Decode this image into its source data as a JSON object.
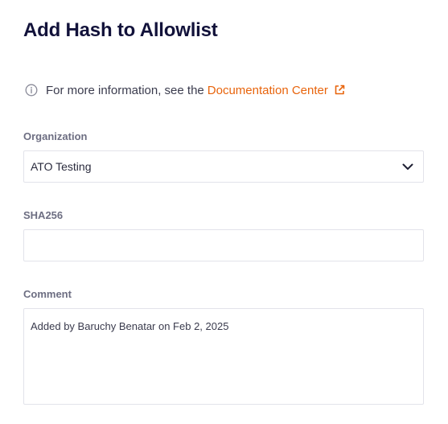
{
  "page": {
    "title": "Add Hash to Allowlist"
  },
  "info": {
    "text": "For more information, see the",
    "link_label": "Documentation Center",
    "icon": "info-circle-icon",
    "link_icon": "external-link-icon",
    "link_color": "#e8640c"
  },
  "organization": {
    "label": "Organization",
    "value": "ATO Testing",
    "icon": "chevron-down-icon"
  },
  "sha256": {
    "label": "SHA256",
    "value": ""
  },
  "comment": {
    "label": "Comment",
    "value": "Added by Baruchy Benatar on Feb 2, 2025"
  }
}
